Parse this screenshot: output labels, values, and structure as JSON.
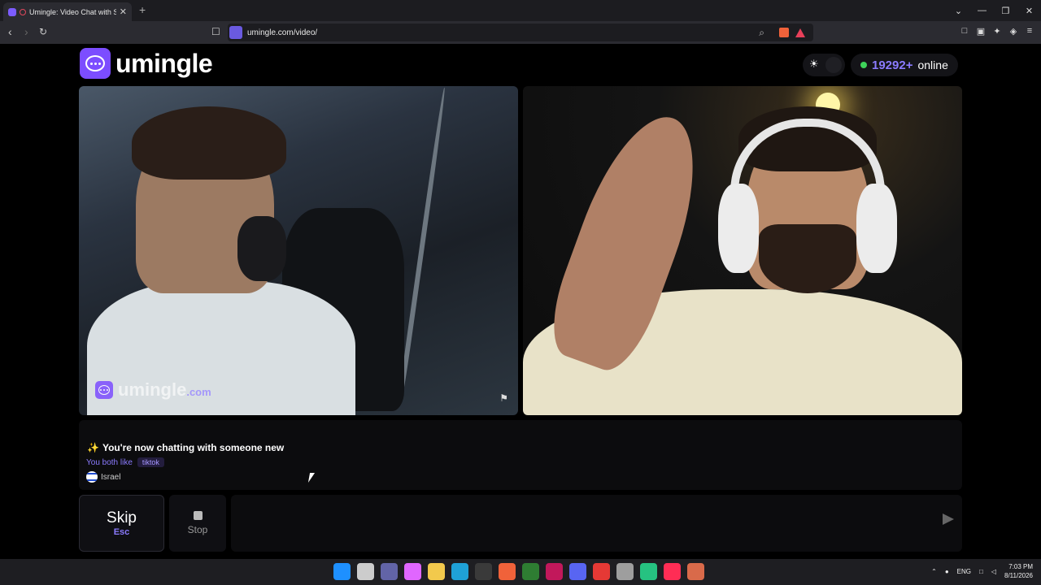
{
  "browser": {
    "tab_title": "Umingle: Video Chat with Stra",
    "tab_close": "✕",
    "new_tab": "+",
    "window_controls": [
      "⌄",
      "—",
      "❐",
      "✕"
    ],
    "url": "umingle.com/video/"
  },
  "header": {
    "logo_text": "umingle",
    "online_count": "19292+",
    "online_label": "online"
  },
  "video": {
    "watermark_text": "umingle",
    "watermark_suffix": ".com"
  },
  "chat": {
    "system_message": "You're now chatting with someone new",
    "sparkle": "✨",
    "likes_label": "You both like",
    "like_tags": [
      "tiktok"
    ],
    "country": "Israel"
  },
  "controls": {
    "skip_label": "Skip",
    "skip_key": "Esc",
    "stop_label": "Stop",
    "message_placeholder": ""
  },
  "taskbar": {
    "lang": "ENG",
    "time": "7:03 PM",
    "date": "8/11/2026",
    "icon_colors": [
      "#1e90ff",
      "#cccccc",
      "#6264a7",
      "#e066ff",
      "#f2c94c",
      "#1fa1d6",
      "#3a3a3a",
      "#f0623a",
      "#2e7d32",
      "#c2185b",
      "#5865f2",
      "#e53935",
      "#9e9e9e",
      "#26c281",
      "#ff2d55",
      "#d96a4a"
    ]
  }
}
